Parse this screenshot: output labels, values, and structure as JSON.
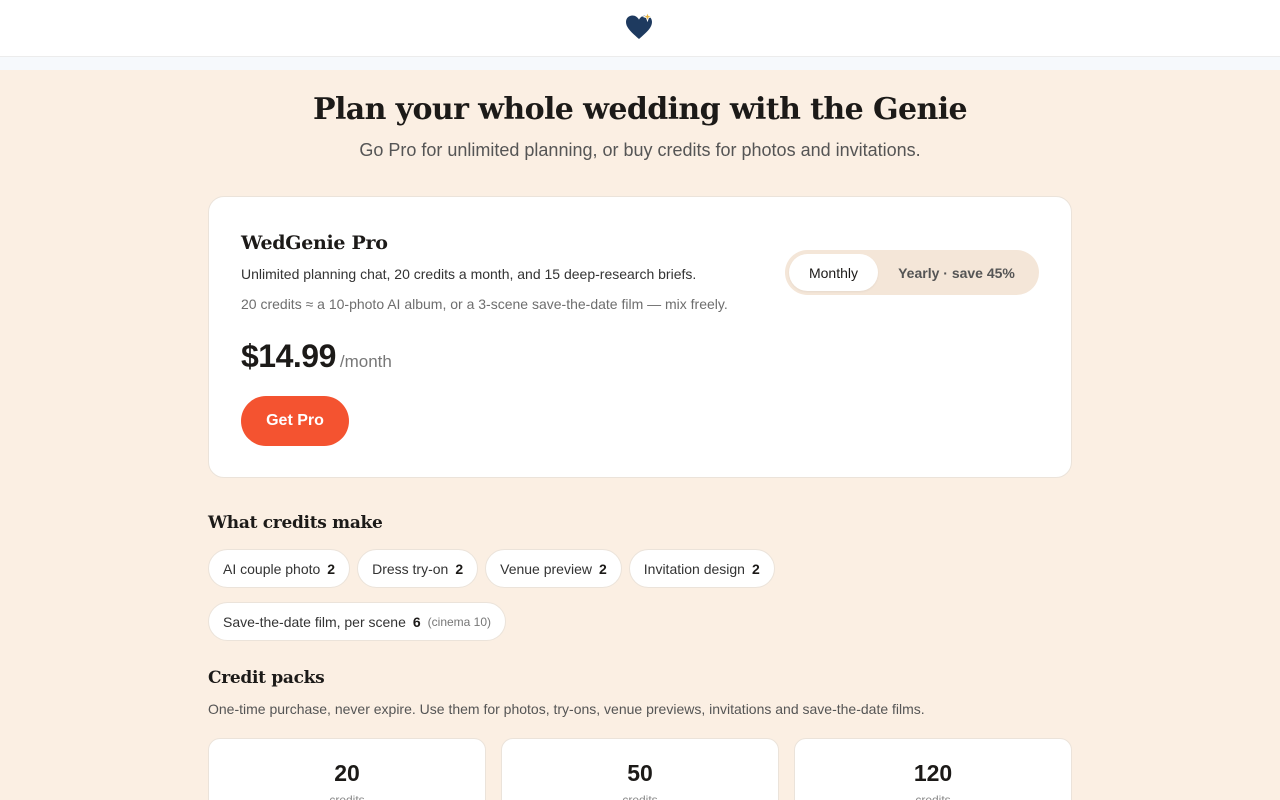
{
  "header": {
    "logo_icon": "heart-sparkle-icon",
    "colors": {
      "heart": "#1e3a5f",
      "sparkle": "#e8b440"
    }
  },
  "hero": {
    "title": "Plan your whole wedding with the Genie",
    "subtitle": "Go Pro for unlimited planning, or buy credits for photos and invitations."
  },
  "pro": {
    "title": "WedGenie Pro",
    "line1": "Unlimited planning chat, 20 credits a month, and 15 deep-research briefs.",
    "line2": "20 credits ≈ a 10-photo AI album, or a 3-scene save-the-date film — mix freely.",
    "price": "$14.99",
    "period": "/month",
    "cta": "Get Pro",
    "billing_toggle": {
      "monthly": "Monthly",
      "yearly": "Yearly · save 45%",
      "selected": "Monthly"
    }
  },
  "credits_section": {
    "title": "What credits make",
    "items": [
      {
        "label": "AI couple photo",
        "value": "2"
      },
      {
        "label": "Dress try-on",
        "value": "2"
      },
      {
        "label": "Venue preview",
        "value": "2"
      },
      {
        "label": "Invitation design",
        "value": "2"
      },
      {
        "label": "Save-the-date film, per scene",
        "value": "6",
        "note": "(cinema 10)"
      }
    ]
  },
  "packs_section": {
    "title": "Credit packs",
    "subtitle": "One-time purchase, never expire. Use them for photos, try-ons, venue previews, invitations and save-the-date films.",
    "packs": [
      {
        "amount": "20",
        "unit": "credits"
      },
      {
        "amount": "50",
        "unit": "credits"
      },
      {
        "amount": "120",
        "unit": "credits"
      }
    ]
  },
  "colors": {
    "background": "#fbefe3",
    "accent": "#f45330",
    "card": "#ffffff"
  }
}
